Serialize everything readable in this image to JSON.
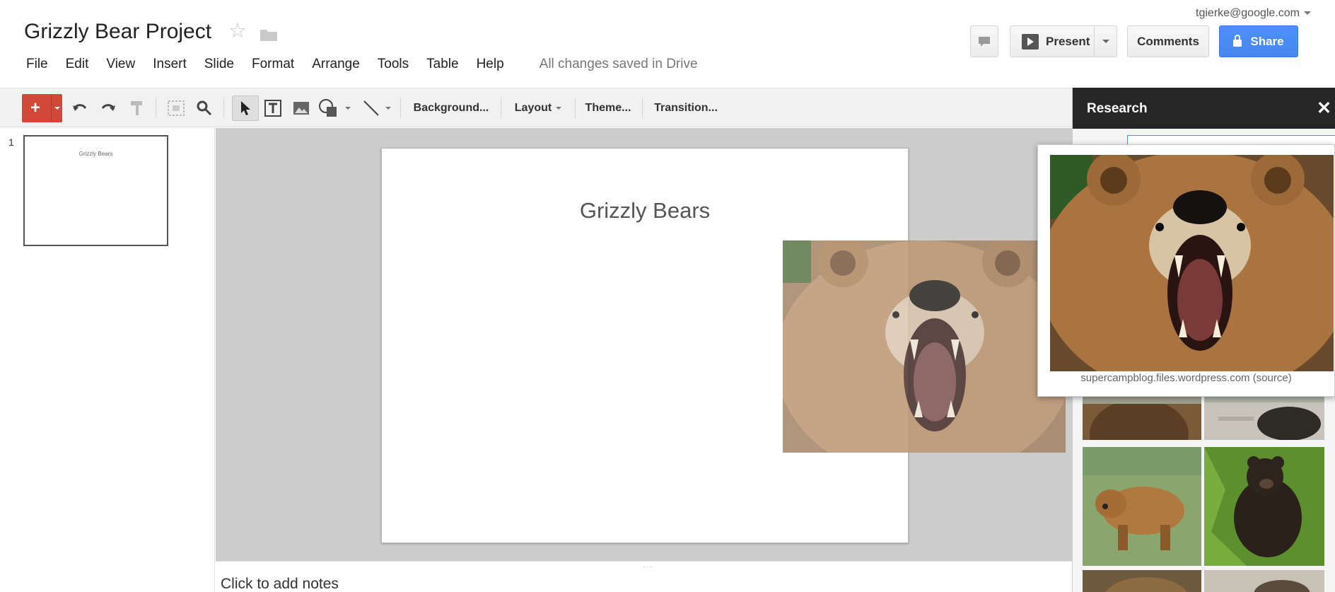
{
  "app": {
    "doc_title": "Grizzly Bear Project",
    "user_email": "tgierke@google.com",
    "save_status": "All changes saved in Drive"
  },
  "menu": [
    "File",
    "Edit",
    "View",
    "Insert",
    "Slide",
    "Format",
    "Arrange",
    "Tools",
    "Table",
    "Help"
  ],
  "header_buttons": {
    "present": "Present",
    "comments": "Comments",
    "share": "Share"
  },
  "toolbar": {
    "new": "+",
    "background": "Background...",
    "layout": "Layout",
    "theme": "Theme...",
    "transition": "Transition..."
  },
  "filmstrip": {
    "slides": [
      {
        "number": "1",
        "title": "Grizzly Bears"
      }
    ]
  },
  "slide": {
    "title": "Grizzly Bears"
  },
  "notes": {
    "placeholder": "Click to add notes"
  },
  "research": {
    "title": "Research",
    "close": "✕",
    "preview_caption": "supercampblog.files.wordpress.com (source)"
  },
  "icons": {
    "star": "star-icon",
    "folder": "folder-icon",
    "comment": "comment-icon",
    "undo": "undo-icon",
    "redo": "redo-icon",
    "paint_format": "paint-format-icon",
    "zoom_fit": "zoom-fit-icon",
    "zoom": "zoom-icon",
    "select": "select-arrow-icon",
    "textbox": "textbox-icon",
    "image": "image-icon",
    "shape": "shape-icon",
    "line": "line-icon",
    "lock": "lock-icon"
  },
  "colors": {
    "new_button": "#d14836",
    "share_button": "#4d90fe",
    "research_header": "#262626"
  }
}
